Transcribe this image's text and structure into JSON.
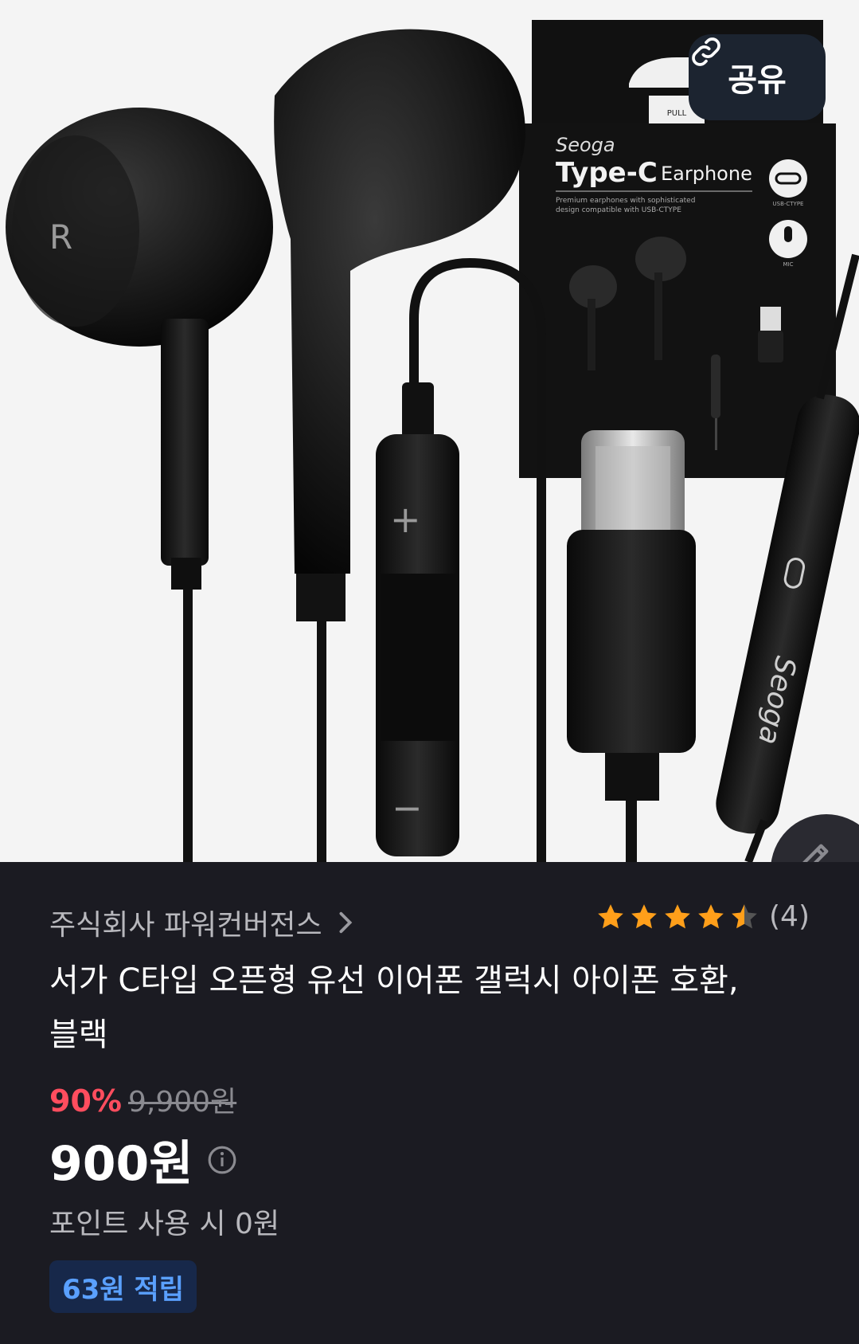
{
  "hero": {
    "packaging_brand": "Seoga",
    "packaging_title": "Type-C",
    "packaging_subtitle": "Earphone",
    "packaging_desc_1": "Premium earphones with sophisticated",
    "packaging_desc_2": "design compatible with USB-CTYPE",
    "packaging_badge_usb": "USB-CTYPE",
    "packaging_badge_mic": "MIC",
    "packaging_pull": "PULL",
    "earbud_mark": "R",
    "remote_brand": "Seoga"
  },
  "share": {
    "label": "공유",
    "icon": "link-icon"
  },
  "edit": {
    "icon": "pencil-icon"
  },
  "product": {
    "seller": "주식회사 파워컨버전스",
    "rating_value": 4.5,
    "review_count": "(4)",
    "title": "서가 C타입 오픈형 유선 이어폰 갤럭시 아이폰 호환, 블랙",
    "discount": "90%",
    "original_price": "9,900원",
    "price": "900원",
    "point_text": "포인트 사용 시 0원",
    "reward": "63원 적립"
  },
  "colors": {
    "accent_red": "#ff4d5e",
    "reward_blue": "#5aa0ff",
    "star": "#ff9f1a",
    "background": "#1b1b22"
  }
}
